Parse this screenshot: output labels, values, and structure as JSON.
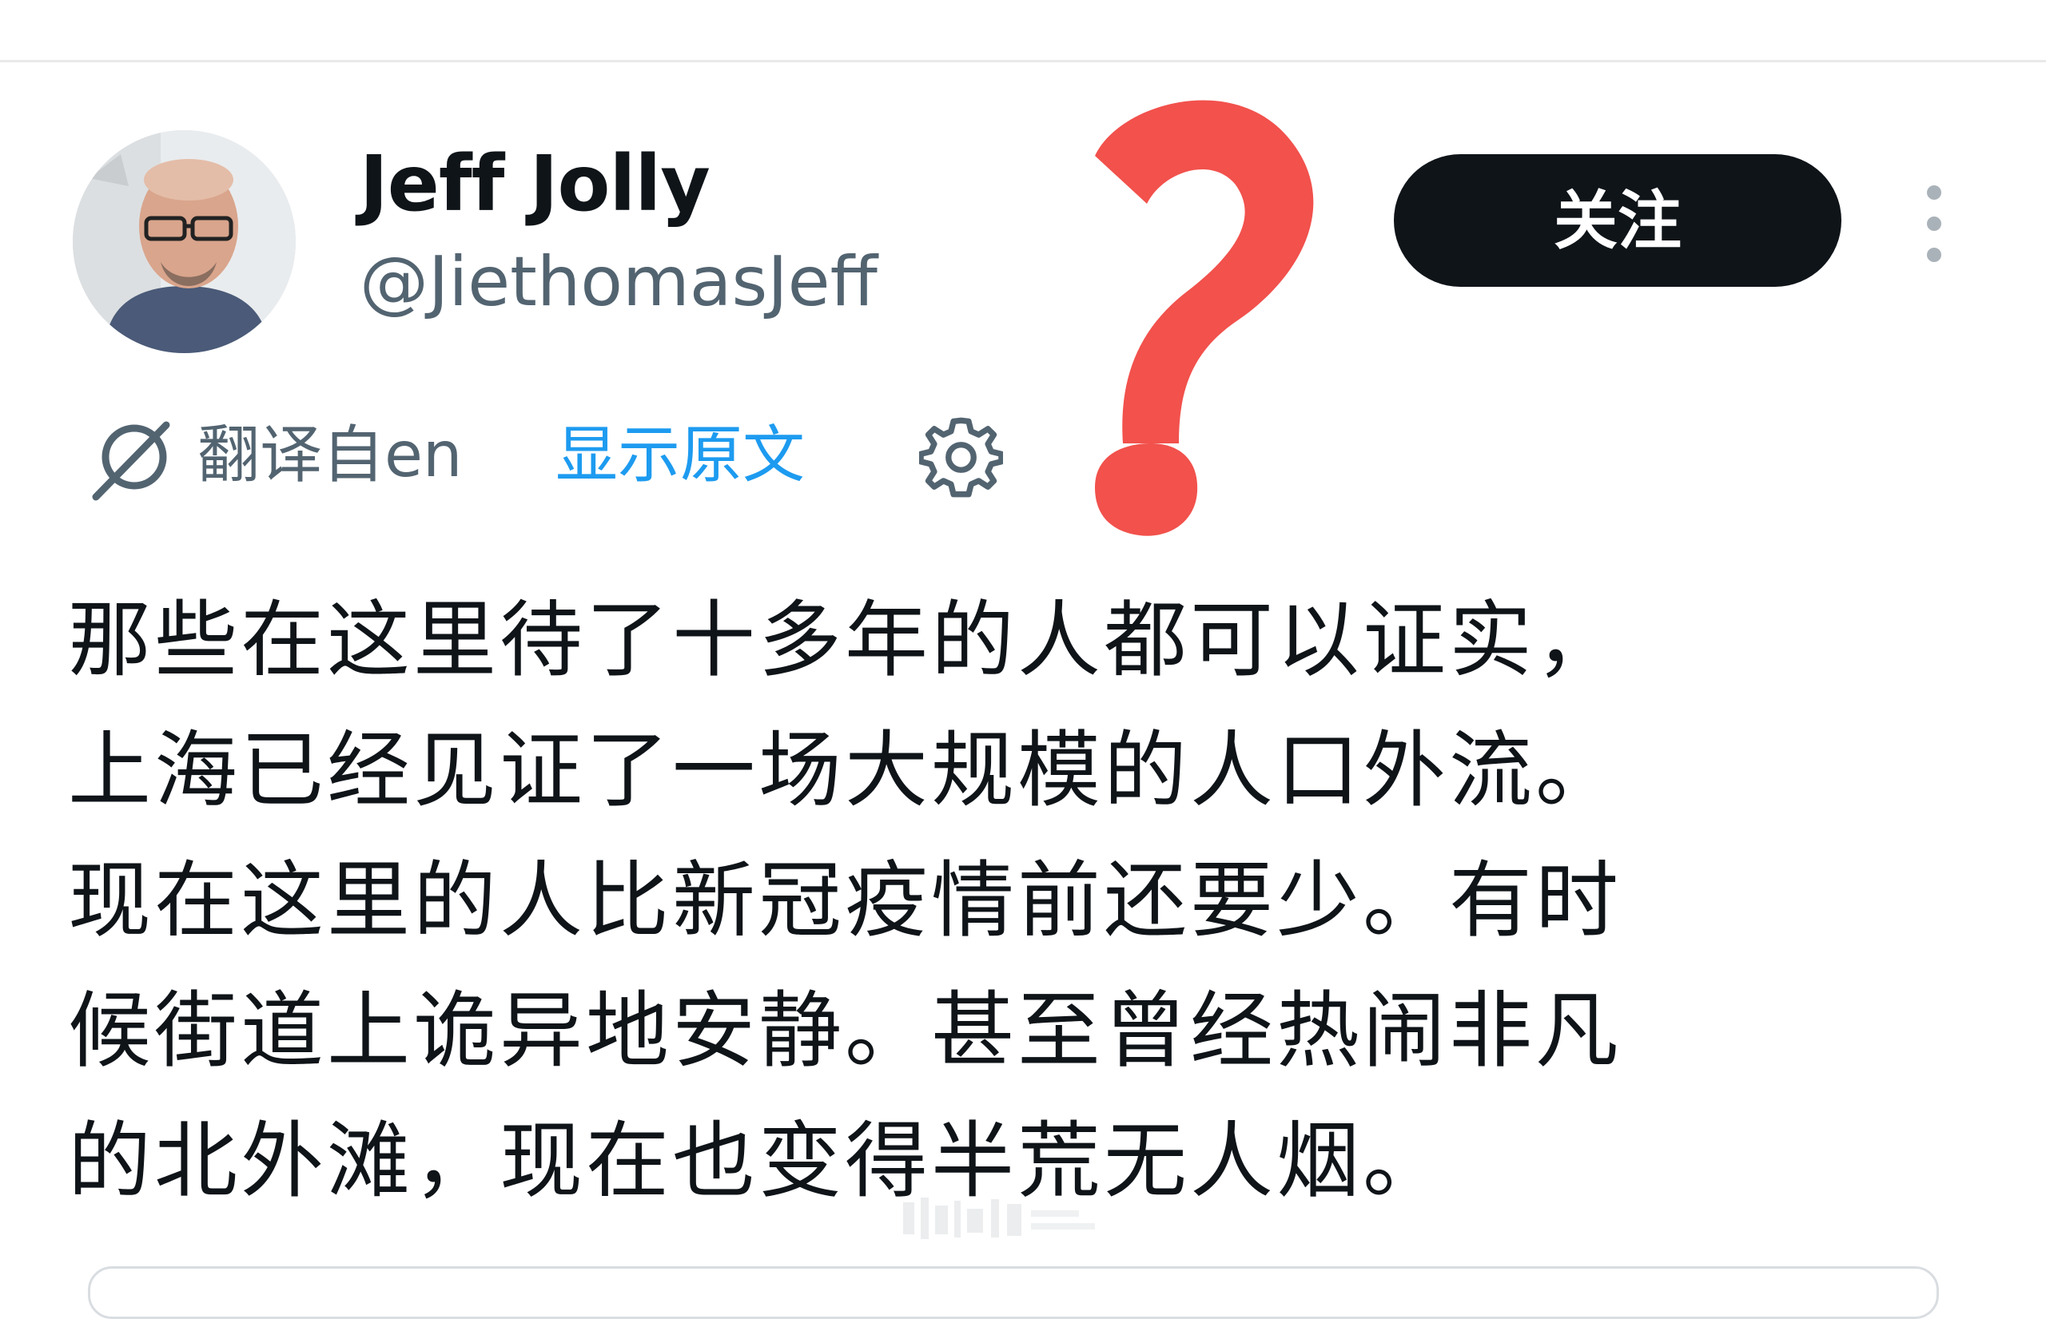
{
  "author": {
    "display_name": "Jeff Jolly",
    "handle": "@JiethomasJeff"
  },
  "actions": {
    "follow_label": "关注"
  },
  "translation": {
    "translated_from": "翻译自en",
    "show_original": "显示原文"
  },
  "tweet": {
    "lines": [
      "那些在这里待了十多年的人都可以证实，",
      "上海已经见证了一场大规模的人口外流。",
      "现在这里的人比新冠疫情前还要少。有时",
      "候街道上诡异地安静。甚至曾经热闹非凡",
      "的北外滩，现在也变得半荒无人烟。"
    ]
  },
  "overlay": {
    "question_mark_color": "#f2514c"
  },
  "colors": {
    "text_primary": "#0f1419",
    "text_secondary": "#536471",
    "link_blue": "#1d9bf0",
    "button_dark": "#0f1419"
  }
}
